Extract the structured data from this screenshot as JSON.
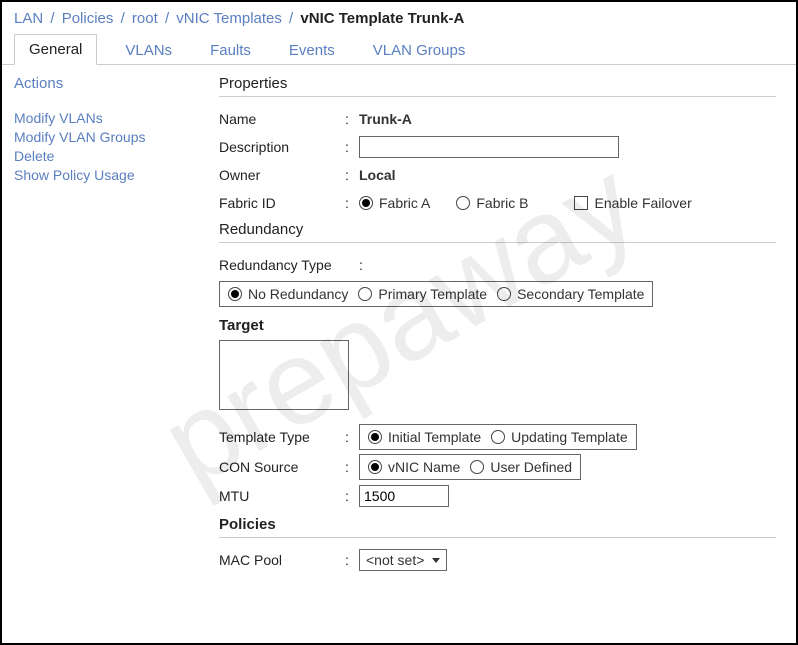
{
  "breadcrumb": {
    "parts": [
      "LAN",
      "Policies",
      "root",
      "vNIC Templates"
    ],
    "current": "vNIC Template Trunk-A"
  },
  "tabs": [
    {
      "label": "General",
      "active": true
    },
    {
      "label": "VLANs",
      "active": false
    },
    {
      "label": "Faults",
      "active": false
    },
    {
      "label": "Events",
      "active": false
    },
    {
      "label": "VLAN Groups",
      "active": false
    }
  ],
  "sidebar": {
    "title": "Actions",
    "links": [
      "Modify VLANs",
      "Modify VLAN Groups",
      "Delete",
      "Show Policy Usage"
    ]
  },
  "properties": {
    "title": "Properties",
    "name_label": "Name",
    "name_value": "Trunk-A",
    "desc_label": "Description",
    "desc_value": "",
    "owner_label": "Owner",
    "owner_value": "Local",
    "fabric_label": "Fabric ID",
    "fabric_a": "Fabric A",
    "fabric_b": "Fabric B",
    "enable_failover": "Enable Failover",
    "fabric_selected": "A",
    "failover_checked": false
  },
  "redundancy": {
    "title": "Redundancy",
    "type_label": "Redundancy Type",
    "options": [
      "No Redundancy",
      "Primary Template",
      "Secondary Template"
    ],
    "selected": 0
  },
  "target": {
    "title": "Target"
  },
  "template": {
    "type_label": "Template Type",
    "type_options": [
      "Initial Template",
      "Updating  Template"
    ],
    "type_selected": 0,
    "con_label": "CON Source",
    "con_options": [
      "vNIC Name",
      "User Defined"
    ],
    "con_selected": 0,
    "mtu_label": "MTU",
    "mtu_value": "1500"
  },
  "policies": {
    "title": "Policies",
    "mac_label": "MAC Pool",
    "mac_value": "<not set>"
  },
  "watermark": "prepaway"
}
